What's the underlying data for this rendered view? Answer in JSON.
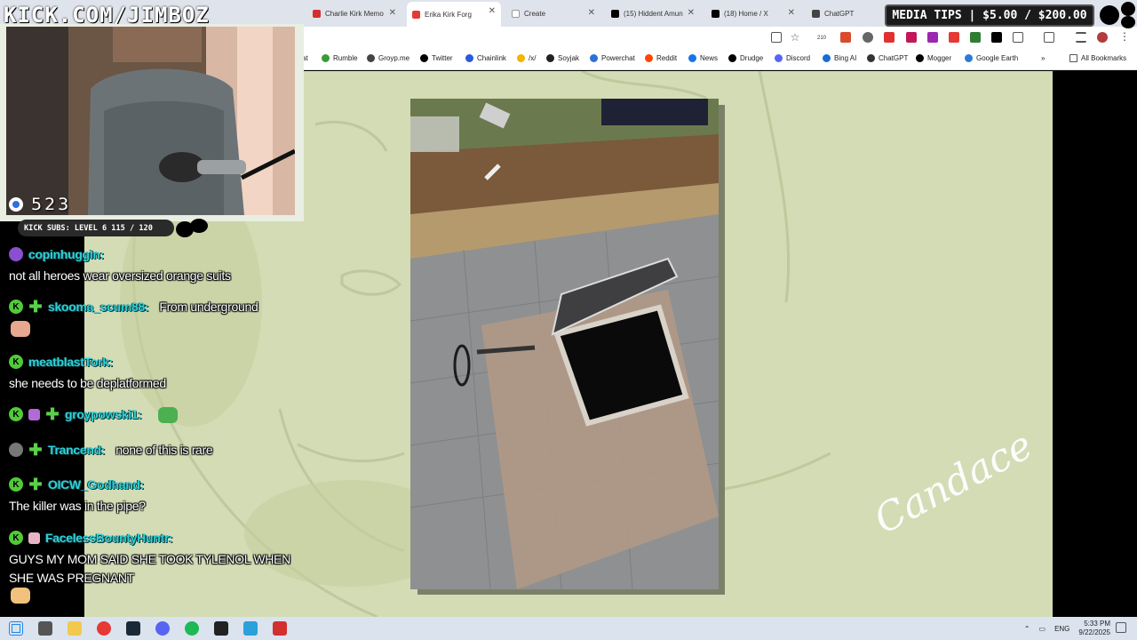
{
  "stream_logo": "KICK.COM/JIMBOZ",
  "media_tips": "MEDIA TIPS | $5.00 / $200.00",
  "browser": {
    "tabs": [
      {
        "label": "Charlie Kirk Memo",
        "color": "#d32f2f",
        "active": false
      },
      {
        "label": "Erika Kirk Forg",
        "color": "#e53935",
        "active": true
      },
      {
        "label": "Create",
        "color": "#ffffff",
        "active": false
      },
      {
        "label": "(15) Hiddent Amun",
        "color": "#000000",
        "active": false
      },
      {
        "label": "(18) Home / X",
        "color": "#000000",
        "active": false
      },
      {
        "label": "ChatGPT",
        "color": "#444444",
        "active": false
      }
    ],
    "toolbar_badge": "210",
    "bookmarks": [
      {
        "label": "at",
        "color": "#00000000"
      },
      {
        "label": "Rumble",
        "color": "#3a9a3a"
      },
      {
        "label": "Groyp.me",
        "color": "#444444"
      },
      {
        "label": "Twitter",
        "color": "#000000"
      },
      {
        "label": "Chainlink",
        "color": "#2a5ada"
      },
      {
        "label": "/x/",
        "color": "#f2b400"
      },
      {
        "label": "Soyjak",
        "color": "#222222"
      },
      {
        "label": "Powerchat",
        "color": "#2f6fdc"
      },
      {
        "label": "Reddit",
        "color": "#ff4500"
      },
      {
        "label": "News",
        "color": "#1a73e8"
      },
      {
        "label": "Drudge",
        "color": "#000000"
      },
      {
        "label": "Discord",
        "color": "#5865f2"
      },
      {
        "label": "Bing AI",
        "color": "#1b6dd0"
      },
      {
        "label": "ChatGPT",
        "color": "#333333"
      },
      {
        "label": "Mogger",
        "color": "#000000"
      },
      {
        "label": "Google Earth",
        "color": "#2b7bd6"
      }
    ],
    "all_bookmarks": "All Bookmarks"
  },
  "viewer_count": "523",
  "kick_subs": "KICK SUBS: LEVEL 6 115 / 120",
  "chat": [
    {
      "badges": [
        "purple"
      ],
      "user": "copinhuggin:",
      "message": "not all heroes wear oversized orange suits",
      "wrap": true,
      "emote": false
    },
    {
      "badges": [
        "kick",
        "clover"
      ],
      "user": "skooma_scum88:",
      "message": "From underground",
      "wrap": false,
      "emote": true
    },
    {
      "badges": [
        "kick"
      ],
      "user": "meatblastTork:",
      "message": "she needs to be deplatformed",
      "wrap": true,
      "emote": false
    },
    {
      "badges": [
        "kick",
        "gift",
        "clover"
      ],
      "user": "groypowski1:",
      "message": "",
      "wrap": false,
      "emote": true
    },
    {
      "badges": [
        "gray",
        "clover"
      ],
      "user": "Trancend:",
      "message": "none of this is rare",
      "wrap": false,
      "emote": false
    },
    {
      "badges": [
        "kick",
        "clover"
      ],
      "user": "OICW_Godhand:",
      "message": "The killer was in the pipe?",
      "wrap": true,
      "emote": false
    },
    {
      "badges": [
        "kick",
        "pinkbox"
      ],
      "user": "FacelessBountyHuntr:",
      "message": "GUYS MY MOM SAID SHE TOOK TYLENOL WHEN SHE WAS PREGNANT",
      "wrap": true,
      "emote": true
    }
  ],
  "signature": "Candace",
  "taskbar": {
    "apps": [
      "start",
      "task-view",
      "file-explorer",
      "chrome",
      "steam",
      "discord",
      "spotify",
      "obs",
      "telegram",
      "app"
    ],
    "lang": "ENG",
    "time": "5:33 PM",
    "date": "9/22/2025"
  }
}
